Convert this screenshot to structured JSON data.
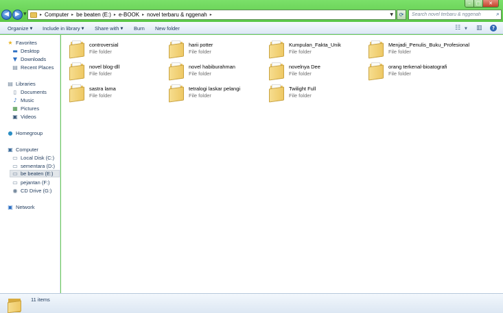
{
  "window": {
    "controls": {
      "minimize": "–",
      "maximize": "□",
      "close": "✕"
    }
  },
  "nav": {
    "back": "◀",
    "forward": "▶",
    "recent": "▼"
  },
  "address": {
    "crumbs": [
      "Computer",
      "be beaten (E:)",
      "e-BOOK",
      "novel terbaru & nggenah"
    ],
    "separator": "▸",
    "dropdown": "▼",
    "refresh": "⟳"
  },
  "search": {
    "placeholder": "Search novel terbaru & nggenah",
    "icon": "⌕"
  },
  "toolbar": {
    "organize": "Organize",
    "include_in_library": "Include in library",
    "share_with": "Share with",
    "burn": "Burn",
    "new_folder": "New folder",
    "caret": "▼",
    "view_icon": "☷",
    "pane_icon": "▥",
    "help_icon": "?"
  },
  "sidebar": {
    "favorites": {
      "label": "Favorites",
      "icon": "★",
      "items": [
        {
          "label": "Desktop",
          "icon": "▬"
        },
        {
          "label": "Downloads",
          "icon": "▼"
        },
        {
          "label": "Recent Places",
          "icon": "▤"
        }
      ]
    },
    "libraries": {
      "label": "Libraries",
      "icon": "▤",
      "items": [
        {
          "label": "Documents",
          "icon": "▯"
        },
        {
          "label": "Music",
          "icon": "♪"
        },
        {
          "label": "Pictures",
          "icon": "▦"
        },
        {
          "label": "Videos",
          "icon": "▣"
        }
      ]
    },
    "homegroup": {
      "label": "Homegroup",
      "icon": "●"
    },
    "computer": {
      "label": "Computer",
      "icon": "▣",
      "items": [
        {
          "label": "Local Disk (C:)",
          "icon": "▭"
        },
        {
          "label": "sementara (D:)",
          "icon": "▭"
        },
        {
          "label": "be beaten (E:)",
          "icon": "▭"
        },
        {
          "label": "pejantan (F:)",
          "icon": "▭"
        },
        {
          "label": "CD Drive (G:)",
          "icon": "◉"
        }
      ]
    },
    "network": {
      "label": "Network",
      "icon": "▣"
    }
  },
  "folders": [
    {
      "name": "controversial",
      "type": "File folder"
    },
    {
      "name": "harii potter",
      "type": "File folder"
    },
    {
      "name": "Kumpulan_Fakta_Unik",
      "type": "File folder"
    },
    {
      "name": "Menjadi_Penulis_Buku_Profesional",
      "type": "File folder"
    },
    {
      "name": "novel blog-dll",
      "type": "File folder"
    },
    {
      "name": "novel habiburahman",
      "type": "File folder"
    },
    {
      "name": "novelnya Dee",
      "type": "File folder"
    },
    {
      "name": "orang terkenal-bioatografi",
      "type": "File folder"
    },
    {
      "name": "sastra lama",
      "type": "File folder"
    },
    {
      "name": "tetralogi laskar pelangi",
      "type": "File folder"
    },
    {
      "name": "Twilight Full",
      "type": "File folder"
    }
  ],
  "status": {
    "count": "11 items"
  }
}
